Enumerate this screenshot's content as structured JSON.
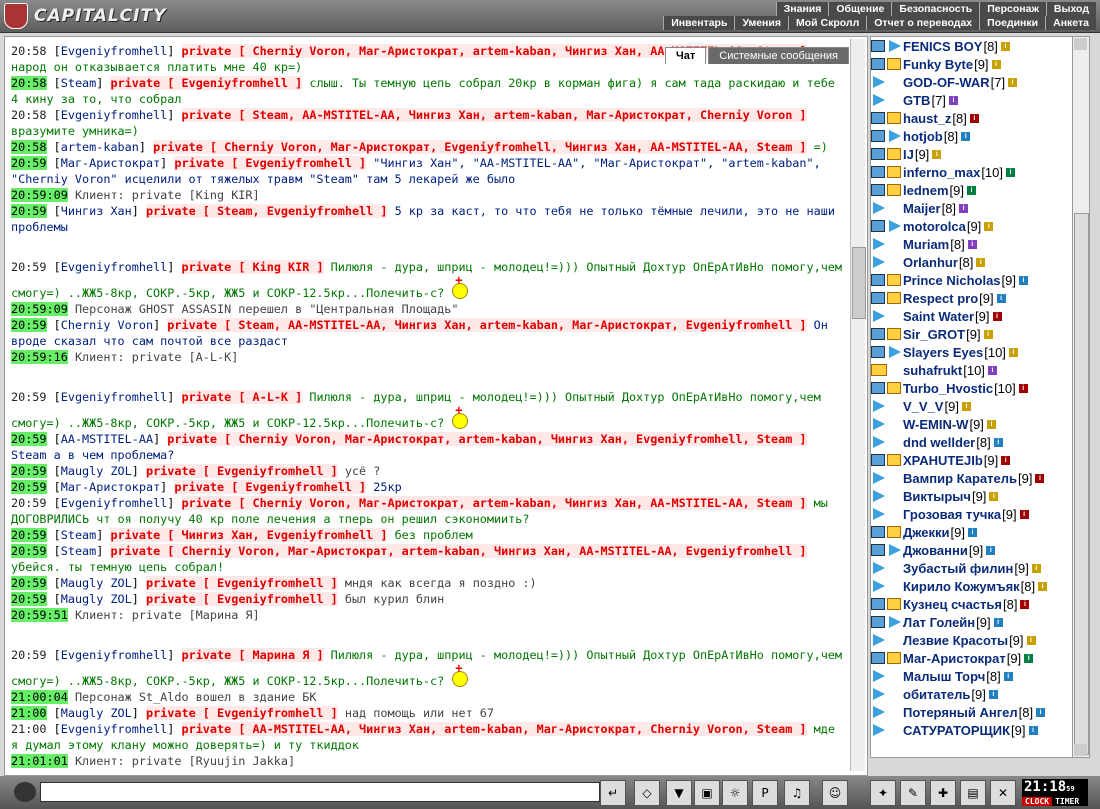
{
  "app": {
    "title": "CAPITALCITY"
  },
  "menu_top": [
    "Знания",
    "Общение",
    "Безопасность",
    "Персонаж",
    "Выход"
  ],
  "menu_bottom": [
    "Инвентарь",
    "Умения",
    "Мой Скролл",
    "Отчет о переводах",
    "Поединки",
    "Анкета"
  ],
  "tabs": {
    "chat": "Чат",
    "system": "Системные сообщения"
  },
  "messages": [
    {
      "time": "20:58",
      "hl": false,
      "nick": "Evgeniyfromhell",
      "priv": "private [ Cherniy Voron, Маг-Аристократ, artem-kaban, Чингиз Хан, AA-MSTITEL-AA, Steam ]",
      "text": " народ он отказывается платить мне 40 кр=)",
      "cls": "green"
    },
    {
      "time": "20:58",
      "hl": true,
      "nick": "Steam",
      "priv": "private [ Evgeniyfromhell ]",
      "text": " слыш. Ты темную цепь собрал 20кр в корман фига) я сам тада раскидаю и тебе 4 кину за то, что собрал",
      "cls": "green"
    },
    {
      "time": "20:58",
      "hl": false,
      "nick": "Evgeniyfromhell",
      "priv": "private [ Steam, AA-MSTITEL-AA, Чингиз Хан, artem-kaban, Маг-Аристократ, Cherniy Voron ]",
      "text": " вразумите умника=)",
      "cls": "green"
    },
    {
      "time": "20:58",
      "hl": true,
      "nick": "artem-kaban",
      "priv": "private [ Cherniy Voron, Маг-Аристократ, Evgeniyfromhell, Чингиз Хан, AA-MSTITEL-AA, Steam ]",
      "text": " =)",
      "cls": "green"
    },
    {
      "time": "20:59",
      "hl": true,
      "nick": "Маг-Аристократ",
      "priv": "private [ Evgeniyfromhell ]",
      "text": " \"Чингиз Хан\", \"AA-MSTITEL-AA\", \"Маг-Аристократ\", \"artem-kaban\", \"Cherniy Voron\" исцелили от тяжелых травм \"Steam\" там 5 лекарей же было",
      "cls": "blue"
    },
    {
      "time": "20:59:09",
      "hl": true,
      "nick": "",
      "priv": "",
      "text": "Клиент: private [King KIR]",
      "cls": "grey",
      "plain": true
    },
    {
      "time": "20:59",
      "hl": true,
      "nick": "Чингиз Хан",
      "priv": "private [ Steam, Evgeniyfromhell ]",
      "text": " 5 кр за каст, то что тебя не только тёмные лечили, это не наши проблемы",
      "cls": "blue"
    },
    {
      "time": "20:59",
      "hl": false,
      "gap": true,
      "nick": "Evgeniyfromhell",
      "priv": "private [ King KIR ]",
      "text": " Пилюля - дура, шприц - молодец!=))) Опытный Дохтур ОпЕрАтИвНо помогу,чем смогу=) ..ЖЖ5-8кр, СОКР.-5кр, ЖЖ5 и СОКР-12.5кр...Полечить-с?",
      "cls": "green",
      "doctor": true
    },
    {
      "time": "20:59:09",
      "hl": true,
      "nick": "",
      "priv": "",
      "text": "Персонаж GHOST ASSASIN перешел в \"Центральная Площадь\"",
      "cls": "grey",
      "plain": true
    },
    {
      "time": "20:59",
      "hl": true,
      "nick": "Cherniy Voron",
      "priv": "private [ Steam, AA-MSTITEL-AA, Чингиз Хан, artem-kaban, Маг-Аристократ, Evgeniyfromhell ]",
      "text": " Он вроде сказал что сам почтой все раздаст",
      "cls": "blue"
    },
    {
      "time": "20:59:16",
      "hl": true,
      "nick": "",
      "priv": "",
      "text": "Клиент: private [A-L-K]",
      "cls": "grey",
      "plain": true
    },
    {
      "time": "20:59",
      "hl": false,
      "gap": true,
      "nick": "Evgeniyfromhell",
      "priv": "private [ A-L-K ]",
      "text": " Пилюля - дура, шприц - молодец!=))) Опытный Дохтур ОпЕрАтИвНо помогу,чем смогу=) ..ЖЖ5-8кр, СОКР.-5кр, ЖЖ5 и СОКР-12.5кр...Полечить-с?",
      "cls": "green",
      "doctor": true
    },
    {
      "time": "20:59",
      "hl": true,
      "nick": "AA-MSTITEL-AA",
      "priv": "private [ Cherniy Voron, Маг-Аристократ, artem-kaban, Чингиз Хан, Evgeniyfromhell, Steam ]",
      "text": " Steam а в чем проблема?",
      "cls": "blue"
    },
    {
      "time": "20:59",
      "hl": true,
      "nick": "Maugly ZOL",
      "priv": "private [ Evgeniyfromhell ]",
      "text": " усё ?",
      "cls": "grey"
    },
    {
      "time": "20:59",
      "hl": true,
      "nick": "Маг-Аристократ",
      "priv": "private [ Evgeniyfromhell ]",
      "text": " 25кр",
      "cls": "blue"
    },
    {
      "time": "20:59",
      "hl": false,
      "nick": "Evgeniyfromhell",
      "priv": "private [ Cherniy Voron, Маг-Аристократ, artem-kaban, Чингиз Хан, AA-MSTITEL-AA, Steam ]",
      "text": " мы ДОГОВРИЛИСЬ чт оя получу 40 кр поле лечения а тперь он решил сэкономиить?",
      "cls": "green"
    },
    {
      "time": "20:59",
      "hl": true,
      "nick": "Steam",
      "priv": "private [ Чингиз Хан, Evgeniyfromhell ]",
      "text": " без проблем",
      "cls": "green"
    },
    {
      "time": "20:59",
      "hl": true,
      "nick": "Steam",
      "priv": "private [ Cherniy Voron, Маг-Аристократ, artem-kaban, Чингиз Хан, AA-MSTITEL-AA, Evgeniyfromhell ]",
      "text": " убейся. ты темную цепь собрал!",
      "cls": "green"
    },
    {
      "time": "20:59",
      "hl": true,
      "nick": "Maugly ZOL",
      "priv": "private [ Evgeniyfromhell ]",
      "text": " мндя как всегда я поздно :)",
      "cls": "grey"
    },
    {
      "time": "20:59",
      "hl": true,
      "nick": "Maugly ZOL",
      "priv": "private [ Evgeniyfromhell ]",
      "text": " был курил блин",
      "cls": "grey"
    },
    {
      "time": "20:59:51",
      "hl": true,
      "nick": "",
      "priv": "",
      "text": "Клиент: private [Марина Я]",
      "cls": "grey",
      "plain": true
    },
    {
      "time": "20:59",
      "hl": false,
      "gap": true,
      "nick": "Evgeniyfromhell",
      "priv": "private [ Марина Я ]",
      "text": " Пилюля - дура, шприц - молодец!=))) Опытный Дохтур ОпЕрАтИвНо помогу,чем смогу=) ..ЖЖ5-8кр, СОКР.-5кр, ЖЖ5 и СОКР-12.5кр...Полечить-с?",
      "cls": "green",
      "doctor": true
    },
    {
      "time": "21:00:04",
      "hl": true,
      "nick": "",
      "priv": "",
      "text": "Персонаж St_Aldo вошел в здание БК",
      "cls": "grey",
      "plain": true
    },
    {
      "time": "21:00",
      "hl": true,
      "nick": "Maugly ZOL",
      "priv": "private [ Evgeniyfromhell ]",
      "text": " над помощь или нет 67",
      "cls": "grey"
    },
    {
      "time": "21:00",
      "hl": false,
      "nick": "Evgeniyfromhell",
      "priv": "private [ AA-MSTITEL-AA, Чингиз Хан, artem-kaban, Маг-Аристократ, Cherniy Voron, Steam ]",
      "text": " мде я думал этому клану можно доверять=) и ту ткиддок",
      "cls": "green"
    },
    {
      "time": "21:01:01",
      "hl": true,
      "nick": "",
      "priv": "",
      "text": "Клиент: private [Ryuujin Jakka]",
      "cls": "grey",
      "plain": true
    }
  ],
  "users": [
    {
      "name": "FENICS BOY",
      "level": "[8]",
      "icons": [
        "env",
        "arr"
      ],
      "info": "#c8a000"
    },
    {
      "name": "Funky Byte",
      "level": "[9]",
      "icons": [
        "env",
        "pri"
      ],
      "info": "#c8a000"
    },
    {
      "name": "GOD-OF-WAR",
      "level": "[7]",
      "icons": [
        "arr"
      ],
      "info": "#c8a000"
    },
    {
      "name": "GTB",
      "level": "[7]",
      "icons": [
        "arr"
      ],
      "info": "#8040c0"
    },
    {
      "name": "haust_z",
      "level": "[8]",
      "icons": [
        "env",
        "pri"
      ],
      "info": "#a00000"
    },
    {
      "name": "hotjob",
      "level": "[8]",
      "icons": [
        "env",
        "arr"
      ],
      "info": "#2080c0"
    },
    {
      "name": "IJ",
      "level": "[9]",
      "icons": [
        "env",
        "pri"
      ],
      "info": "#c8a000"
    },
    {
      "name": "inferno_max",
      "level": "[10]",
      "icons": [
        "env",
        "pri"
      ],
      "info": "#008040"
    },
    {
      "name": "lednem",
      "level": "[9]",
      "icons": [
        "env",
        "pri"
      ],
      "info": "#008040"
    },
    {
      "name": "Maijer",
      "level": "[8]",
      "icons": [
        "arr"
      ],
      "info": "#8040c0"
    },
    {
      "name": "motorolca",
      "level": "[9]",
      "icons": [
        "env",
        "arr"
      ],
      "info": "#c8a000"
    },
    {
      "name": "Muriam",
      "level": "[8]",
      "icons": [
        "arr"
      ],
      "info": "#8040c0"
    },
    {
      "name": "Orlanhur",
      "level": "[8]",
      "icons": [
        "arr"
      ],
      "info": "#c8a000"
    },
    {
      "name": "Prince Nicholas",
      "level": "[9]",
      "icons": [
        "env",
        "pri"
      ],
      "info": "#2080c0"
    },
    {
      "name": "Respect pro",
      "level": "[9]",
      "icons": [
        "env",
        "pri"
      ],
      "info": "#2080c0"
    },
    {
      "name": "Saint Water",
      "level": "[9]",
      "icons": [
        "arr"
      ],
      "info": "#a00000"
    },
    {
      "name": "Sir_GROT",
      "level": "[9]",
      "icons": [
        "env",
        "pri"
      ],
      "info": "#c8a000"
    },
    {
      "name": "Slayers Eyes",
      "level": "[10]",
      "icons": [
        "env",
        "arr"
      ],
      "info": "#c8a000"
    },
    {
      "name": "suhafrukt",
      "level": "[10]",
      "icons": [
        "pri"
      ],
      "info": "#8040c0"
    },
    {
      "name": "Turbo_Hvostic",
      "level": "[10]",
      "icons": [
        "env",
        "pri"
      ],
      "info": "#a00000"
    },
    {
      "name": "V_V_V",
      "level": "[9]",
      "icons": [
        "arr"
      ],
      "info": "#c8a000"
    },
    {
      "name": "W-EMIN-W",
      "level": "[9]",
      "icons": [
        "arr"
      ],
      "info": "#c8a000"
    },
    {
      "name": "dnd wellder",
      "level": "[8]",
      "icons": [
        "arr"
      ],
      "info": "#2080c0"
    },
    {
      "name": "ХРАНUTEJIb",
      "level": "[9]",
      "icons": [
        "env",
        "pri"
      ],
      "info": "#a00000"
    },
    {
      "name": "Вампир Каратель",
      "level": "[9]",
      "icons": [
        "arr"
      ],
      "info": "#a00000"
    },
    {
      "name": "Виктырыч",
      "level": "[9]",
      "icons": [
        "arr"
      ],
      "info": "#c8a000"
    },
    {
      "name": "Грозовая тучка",
      "level": "[9]",
      "icons": [
        "arr"
      ],
      "info": "#a00000"
    },
    {
      "name": "Джекки",
      "level": "[9]",
      "icons": [
        "env",
        "pri"
      ],
      "info": "#2080c0"
    },
    {
      "name": "Джованни",
      "level": "[9]",
      "icons": [
        "env",
        "arr"
      ],
      "info": "#2080c0"
    },
    {
      "name": "Зубастый филин",
      "level": "[9]",
      "icons": [
        "arr"
      ],
      "info": "#c8a000"
    },
    {
      "name": "Кирило Кожумъяк",
      "level": "[8]",
      "icons": [
        "arr"
      ],
      "info": "#c8a000"
    },
    {
      "name": "Кузнец счастья",
      "level": "[8]",
      "icons": [
        "env",
        "pri"
      ],
      "info": "#a00000"
    },
    {
      "name": "Лат Голейн",
      "level": "[9]",
      "icons": [
        "env",
        "arr"
      ],
      "info": "#2080c0"
    },
    {
      "name": "Лезвие Красоты",
      "level": "[9]",
      "icons": [
        "arr"
      ],
      "info": "#c8a000"
    },
    {
      "name": "Маг-Аристократ",
      "level": "[9]",
      "icons": [
        "env",
        "pri"
      ],
      "info": "#008040"
    },
    {
      "name": "Малыш Торч",
      "level": "[8]",
      "icons": [
        "arr"
      ],
      "info": "#2080c0"
    },
    {
      "name": "обитатель",
      "level": "[9]",
      "icons": [
        "arr"
      ],
      "info": "#2080c0"
    },
    {
      "name": "Потеряный Ангел",
      "level": "[8]",
      "icons": [
        "arr"
      ],
      "info": "#2080c0"
    },
    {
      "name": "САТУРАТОРЩИК",
      "level": "[9]",
      "icons": [
        "arr"
      ],
      "info": "#2080c0"
    }
  ],
  "input": {
    "placeholder": ""
  },
  "toolbar": [
    "send-icon",
    "clear-icon",
    "filter-icon",
    "save-icon",
    "smile-icon"
  ],
  "clock": {
    "time": "21:18",
    "sec": "59",
    "clock_label": "CLOCK",
    "timer_label": "TIMER"
  }
}
